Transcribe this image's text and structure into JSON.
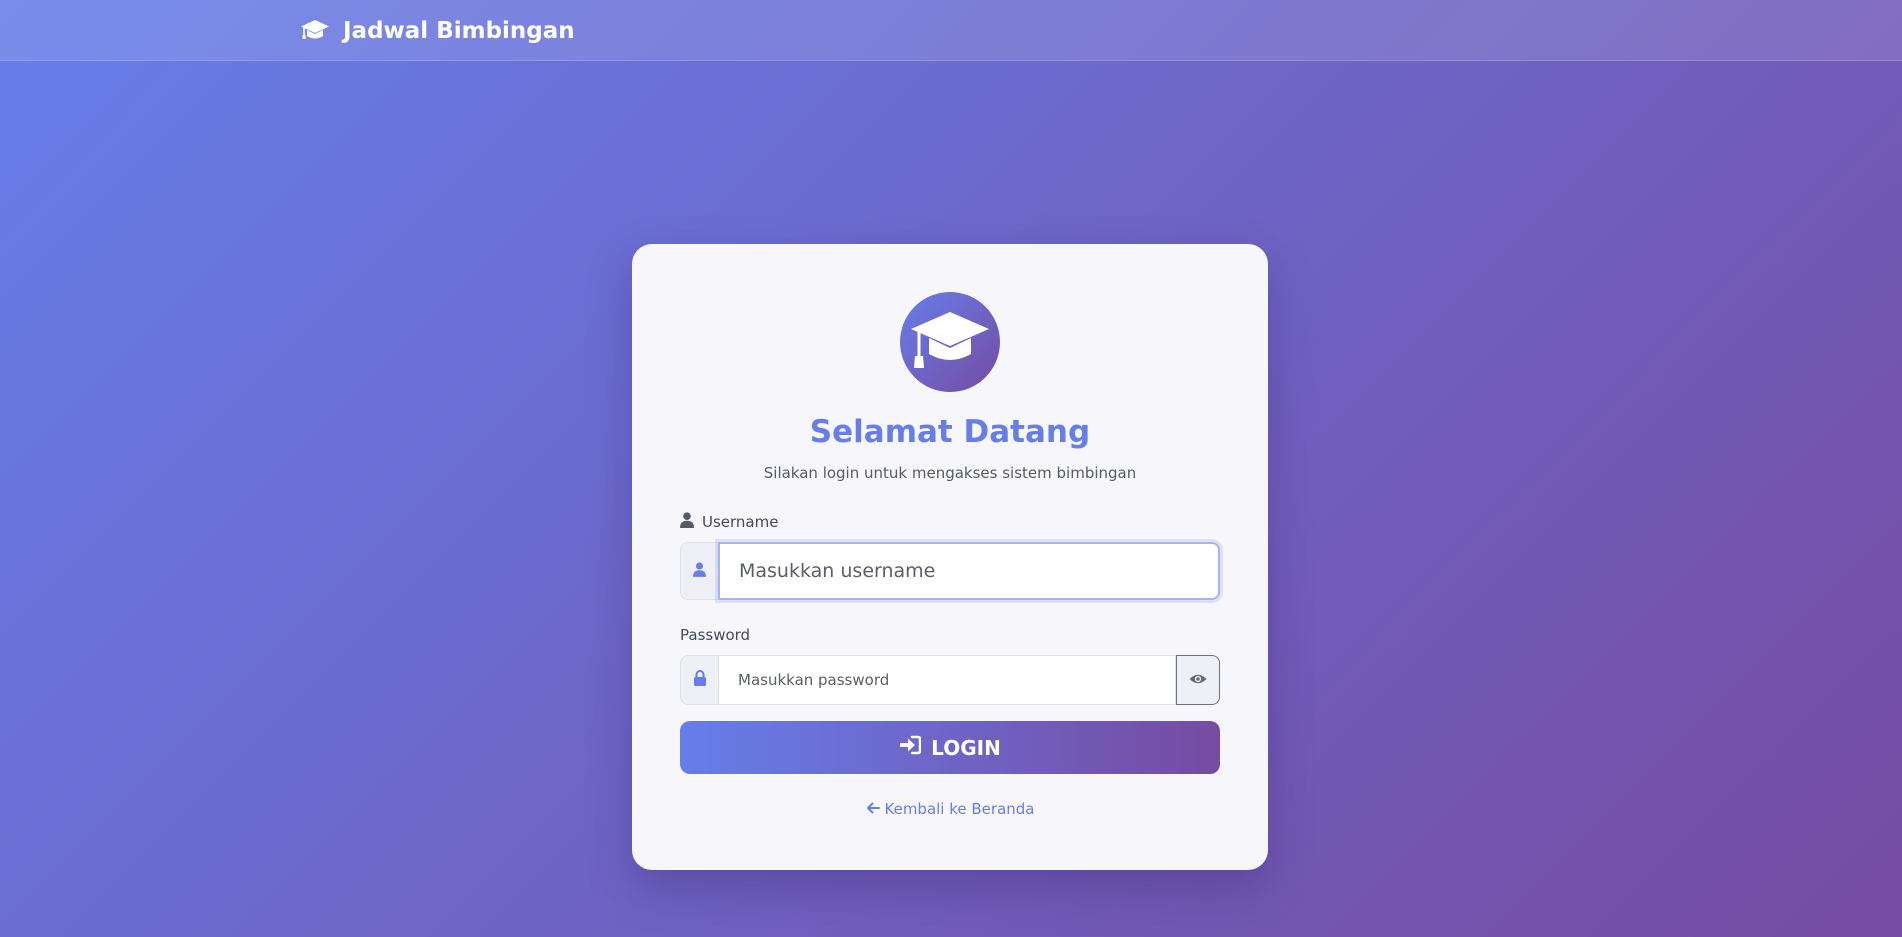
{
  "navbar": {
    "brand_text": "Jadwal Bimbingan",
    "brand_icon": "graduation-cap-icon"
  },
  "login_card": {
    "logo_icon": "graduation-cap-icon",
    "title": "Selamat Datang",
    "subtitle": "Silakan login untuk mengakses sistem bimbingan",
    "username": {
      "label": "Username",
      "label_icon": "user-icon",
      "addon_icon": "user-icon",
      "placeholder": "Masukkan username",
      "value": ""
    },
    "password": {
      "label": "Password",
      "addon_icon": "lock-icon",
      "placeholder": "Masukkan password",
      "value": "",
      "toggle_icon": "eye-icon"
    },
    "login_button": {
      "label": "LOGIN",
      "icon": "sign-in-icon"
    },
    "back_link": {
      "label": "Kembali ke Beranda",
      "icon": "arrow-left-icon"
    }
  },
  "colors": {
    "gradient_start": "#667eea",
    "gradient_end": "#764ba2",
    "card_background": "#f7f7fb",
    "accent": "#667eea"
  }
}
